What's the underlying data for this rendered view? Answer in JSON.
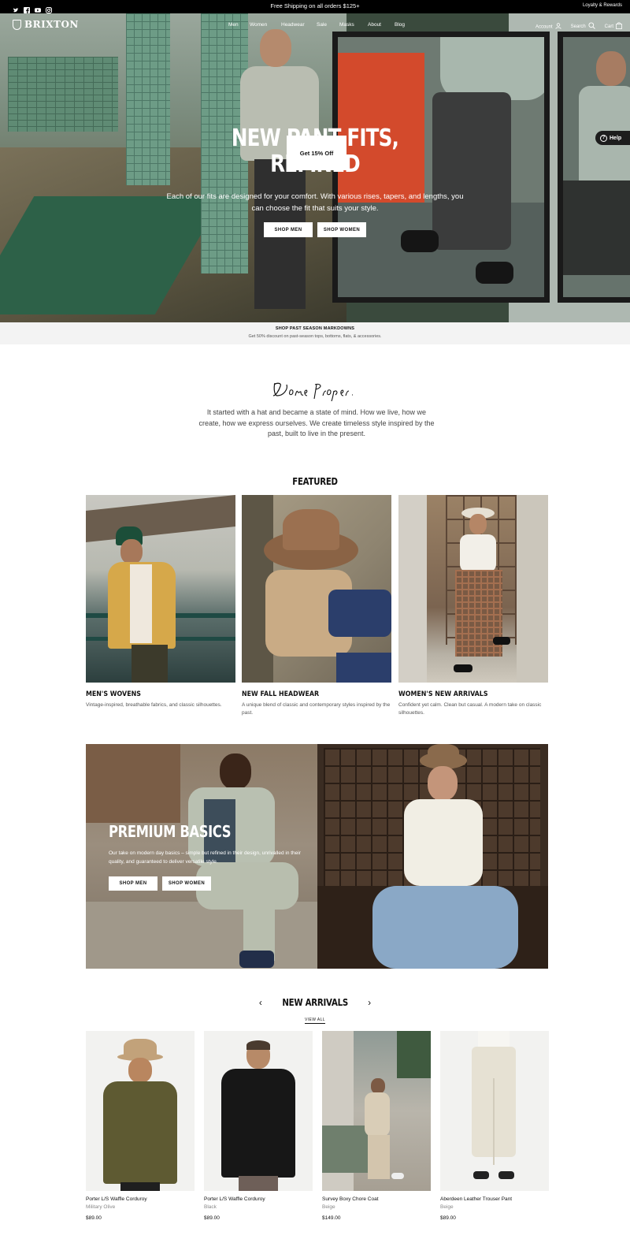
{
  "topbar": {
    "announcement": "Free Shipping on all orders $125+",
    "loyalty": "Loyalty & Rewards",
    "socials": [
      "twitter-icon",
      "facebook-icon",
      "youtube-icon",
      "instagram-icon"
    ]
  },
  "header": {
    "logo": "BRIXTON",
    "nav": [
      "Men",
      "Women",
      "Headwear",
      "Sale",
      "Masks",
      "About",
      "Blog"
    ],
    "account": "Account",
    "search": "Search",
    "cart": "Cart"
  },
  "hero": {
    "headline_line1": "NEW PANT FITS,",
    "headline_line2": "REFINED",
    "subtext": "Each of our fits are designed for your comfort. With various rises, tapers, and lengths, you can choose the fit that suits your style.",
    "shop_men": "SHOP MEN",
    "shop_women": "SHOP WOMEN"
  },
  "popup": {
    "label": "Get 15% Off"
  },
  "help": {
    "label": "Help"
  },
  "promo": {
    "title": "SHOP PAST SEASON MARKDOWNS",
    "text": "Get 50% discount on past-season tops, bottoms, flats, & accessories."
  },
  "story": {
    "script": "Done Proper.",
    "text": "It started with a hat and became a state of mind. How we live, how we create, how we express ourselves. We create timeless style inspired by the past, built to live in the present."
  },
  "featured": {
    "title": "FEATURED",
    "cards": [
      {
        "title": "MEN'S WOVENS",
        "desc": "Vintage-inspired, breathable fabrics, and classic silhouettes."
      },
      {
        "title": "NEW FALL HEADWEAR",
        "desc": "A unique blend of classic and contemporary styles inspired by the past."
      },
      {
        "title": "WOMEN'S NEW ARRIVALS",
        "desc": "Confident yet calm. Clean but casual. A modern take on classic silhouettes."
      }
    ]
  },
  "premium": {
    "title": "PREMIUM BASICS",
    "desc": "Our take on modern day basics – simple but refined in their design, unrivalled in their quality, and guaranteed to deliver versatile style.",
    "shop_men": "SHOP MEN",
    "shop_women": "SHOP WOMEN"
  },
  "arrivals": {
    "title": "NEW ARRIVALS",
    "view_all": "VIEW ALL",
    "prev": "‹",
    "next": "›",
    "products": [
      {
        "name": "Porter L/S Waffle Corduroy",
        "color": "Military Olive",
        "price": "$89.00"
      },
      {
        "name": "Porter L/S Waffle Corduroy",
        "color": "Black",
        "price": "$89.00"
      },
      {
        "name": "Survey Boxy Chore Coat",
        "color": "Beige",
        "price": "$149.00"
      },
      {
        "name": "Aberdeen Leather Trouser Pant",
        "color": "Beige",
        "price": "$89.00"
      }
    ]
  }
}
